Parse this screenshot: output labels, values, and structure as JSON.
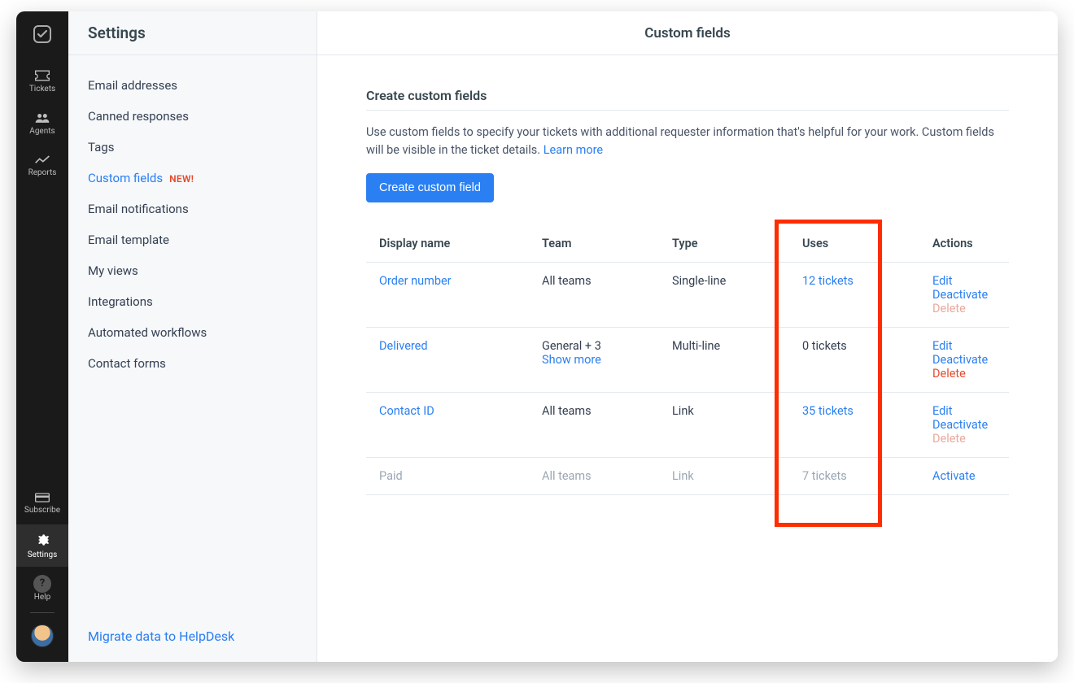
{
  "rail": {
    "items": [
      {
        "icon": "ticket",
        "label": "Tickets"
      },
      {
        "icon": "agents",
        "label": "Agents"
      },
      {
        "icon": "reports",
        "label": "Reports"
      }
    ],
    "bottom": {
      "subscribe": "Subscribe",
      "settings": "Settings",
      "help": "Help"
    }
  },
  "sidebar": {
    "title": "Settings",
    "items": [
      {
        "label": "Email addresses"
      },
      {
        "label": "Canned responses"
      },
      {
        "label": "Tags"
      },
      {
        "label": "Custom fields",
        "active": true,
        "badge": "NEW!"
      },
      {
        "label": "Email notifications"
      },
      {
        "label": "Email template"
      },
      {
        "label": "My views"
      },
      {
        "label": "Integrations"
      },
      {
        "label": "Automated workflows"
      },
      {
        "label": "Contact forms"
      }
    ],
    "footer_link": "Migrate data to HelpDesk"
  },
  "main": {
    "title": "Custom fields",
    "section_title": "Create custom fields",
    "help_text": "Use custom fields to specify your tickets with additional requester information that's helpful for your work. Custom fields will be visible in the ticket details. ",
    "learn_more": "Learn more",
    "create_button": "Create custom field"
  },
  "table": {
    "headers": {
      "display_name": "Display name",
      "team": "Team",
      "type": "Type",
      "uses": "Uses",
      "actions": "Actions"
    },
    "rows": [
      {
        "name": "Order number",
        "team": "All teams",
        "team_more": "",
        "type": "Single-line",
        "uses": "12 tickets",
        "uses_link": true,
        "actions": [
          "Edit",
          "Deactivate",
          "Delete"
        ],
        "delete_muted": true,
        "muted": false
      },
      {
        "name": "Delivered",
        "team": "General + 3",
        "team_more": "Show more",
        "type": "Multi-line",
        "uses": "0 tickets",
        "uses_link": false,
        "actions": [
          "Edit",
          "Deactivate",
          "Delete"
        ],
        "delete_muted": false,
        "muted": false
      },
      {
        "name": "Contact ID",
        "team": "All teams",
        "team_more": "",
        "type": "Link",
        "uses": "35 tickets",
        "uses_link": true,
        "actions": [
          "Edit",
          "Deactivate",
          "Delete"
        ],
        "delete_muted": true,
        "muted": false
      },
      {
        "name": "Paid",
        "team": "All teams",
        "team_more": "",
        "type": "Link",
        "uses": "7 tickets",
        "uses_link": true,
        "actions": [
          "Activate"
        ],
        "delete_muted": false,
        "muted": true
      }
    ]
  }
}
